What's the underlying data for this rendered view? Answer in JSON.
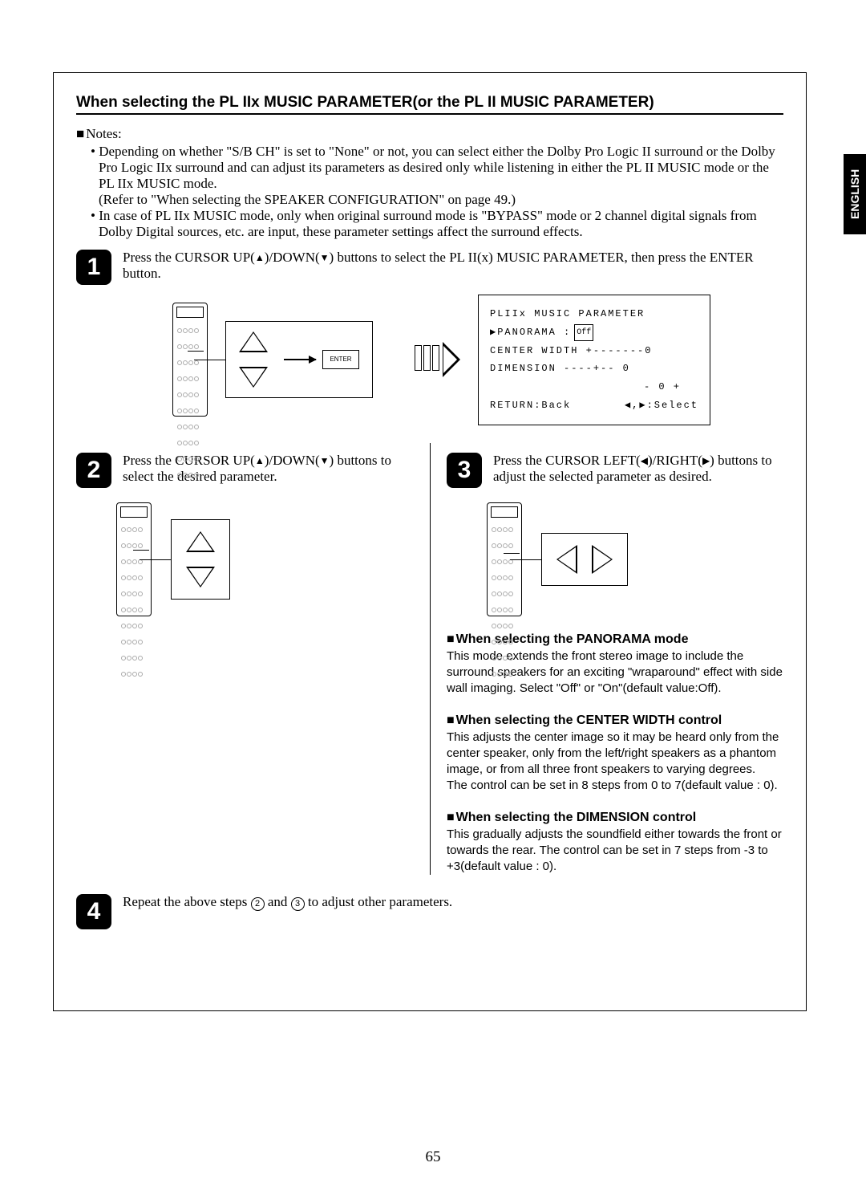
{
  "lang_tab": "ENGLISH",
  "title": "When selecting the PL IIx MUSIC  PARAMETER(or the PL II MUSIC PARAMETER)",
  "notes_label": "Notes:",
  "notes": [
    "Depending on whether \"S/B CH\" is set to \"None\" or not, you can select either the Dolby Pro Logic II surround or the Dolby Pro Logic IIx surround and can adjust its parameters as desired only while listening in either the PL II MUSIC mode or the PL IIx MUSIC mode.",
    "In case of PL IIx MUSIC mode, only when original surround mode is \"BYPASS\" mode or 2 channel digital signals from Dolby Digital sources, etc. are input, these parameter settings affect the surround effects."
  ],
  "note1_ref": "(Refer to \"When selecting the SPEAKER CONFIGURATION\" on page 49.)",
  "step1": {
    "num": "1",
    "text_a": "Press the CURSOR UP(",
    "text_b": ")/DOWN(",
    "text_c": ") buttons to select the PL II(x) MUSIC PARAMETER, then press the ENTER button.",
    "enter": "ENTER"
  },
  "osd": {
    "title": "PLIIx MUSIC PARAMETER",
    "r1a": "▶PANORAMA :",
    "r1b": "Off",
    "r2": "CENTER WIDTH +-------0",
    "r3": "DIMENSION   ----+-- 0",
    "r3b": "- 0 +",
    "r4a": "RETURN:Back",
    "r4b": "◀,▶:Select"
  },
  "step2": {
    "num": "2",
    "text_a": "Press the CURSOR UP(",
    "text_b": ")/DOWN(",
    "text_c": ") buttons to select the desired parameter."
  },
  "step3": {
    "num": "3",
    "text_a": "Press the CURSOR LEFT(",
    "text_b": ")/RIGHT(",
    "text_c": ") buttons to adjust the selected parameter as desired."
  },
  "panorama": {
    "h": "When selecting the PANORAMA mode",
    "p": "This mode extends the front stereo image to include the surround speakers for an exciting \"wraparound\" effect with side wall imaging. Select \"Off\" or \"On\"(default value:Off)."
  },
  "center": {
    "h": "When selecting the CENTER WIDTH control",
    "p1": "This adjusts the center image so it may be heard only from the center speaker, only from the left/right speakers as a phantom image, or from all three front speakers to varying degrees.",
    "p2": "The control can be set in 8 steps from 0 to 7(default value : 0)."
  },
  "dimension": {
    "h": "When selecting the DIMENSION control",
    "p": "This gradually adjusts the soundfield either towards the front or towards the rear. The control can be set in 7 steps from -3 to +3(default value : 0)."
  },
  "step4": {
    "num": "4",
    "text_a": "Repeat the above steps ",
    "c2": "2",
    "text_b": " and ",
    "c3": "3",
    "text_c": " to adjust other parameters."
  },
  "page_number": "65"
}
